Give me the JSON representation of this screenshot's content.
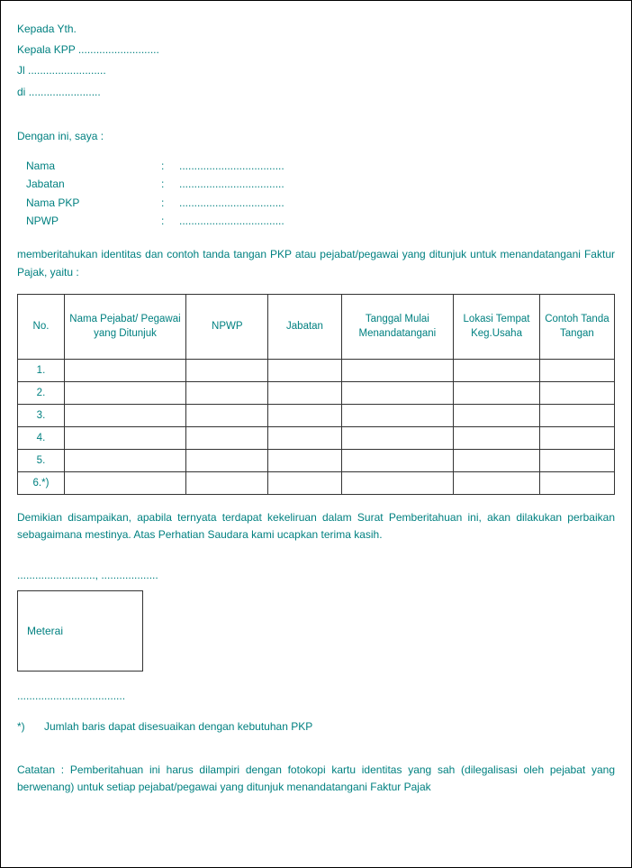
{
  "header": {
    "line1": "Kepada Yth.",
    "line2_prefix": "Kepala KPP ",
    "line2_dots": "...........................",
    "line3_prefix": "Jl ",
    "line3_dots": "..........................",
    "line4_prefix": "di ",
    "line4_dots": "........................"
  },
  "intro": "Dengan ini, saya :",
  "fields": [
    {
      "label": "Nama",
      "value": "..................................."
    },
    {
      "label": "Jabatan",
      "value": "..................................."
    },
    {
      "label": "Nama PKP",
      "value": "..................................."
    },
    {
      "label": "NPWP",
      "value": "..................................."
    }
  ],
  "para1": "memberitahukan identitas dan contoh tanda tangan PKP atau pejabat/pegawai yang ditunjuk untuk menandatangani Faktur Pajak, yaitu :",
  "table": {
    "headers": {
      "no": "No.",
      "nama": "Nama Pejabat/ Pegawai yang Ditunjuk",
      "npwp": "NPWP",
      "jabatan": "Jabatan",
      "tgl": "Tanggal Mulai Menandatangani",
      "lokasi": "Lokasi Tempat Keg.Usaha",
      "contoh": "Contoh Tanda Tangan"
    },
    "rows": [
      "1.",
      "2.",
      "3.",
      "4.",
      "5.",
      "6.*)"
    ]
  },
  "closing": "Demikian disampaikan, apabila ternyata terdapat kekeliruan dalam Surat Pemberitahuan ini, akan dilakukan perbaikan sebagaimana mestinya. Atas Perhatian Saudara kami ucapkan terima kasih.",
  "place_date": ".........................., ...................",
  "meterai": "Meterai",
  "sig_line": "....................................",
  "footnote": {
    "mark": "*)",
    "text": "Jumlah baris dapat disesuaikan dengan kebutuhan PKP"
  },
  "catatan": "Catatan : Pemberitahuan ini harus dilampiri dengan fotokopi kartu identitas yang sah (dilegalisasi oleh pejabat yang berwenang) untuk setiap pejabat/pegawai yang ditunjuk menandatangani Faktur Pajak"
}
